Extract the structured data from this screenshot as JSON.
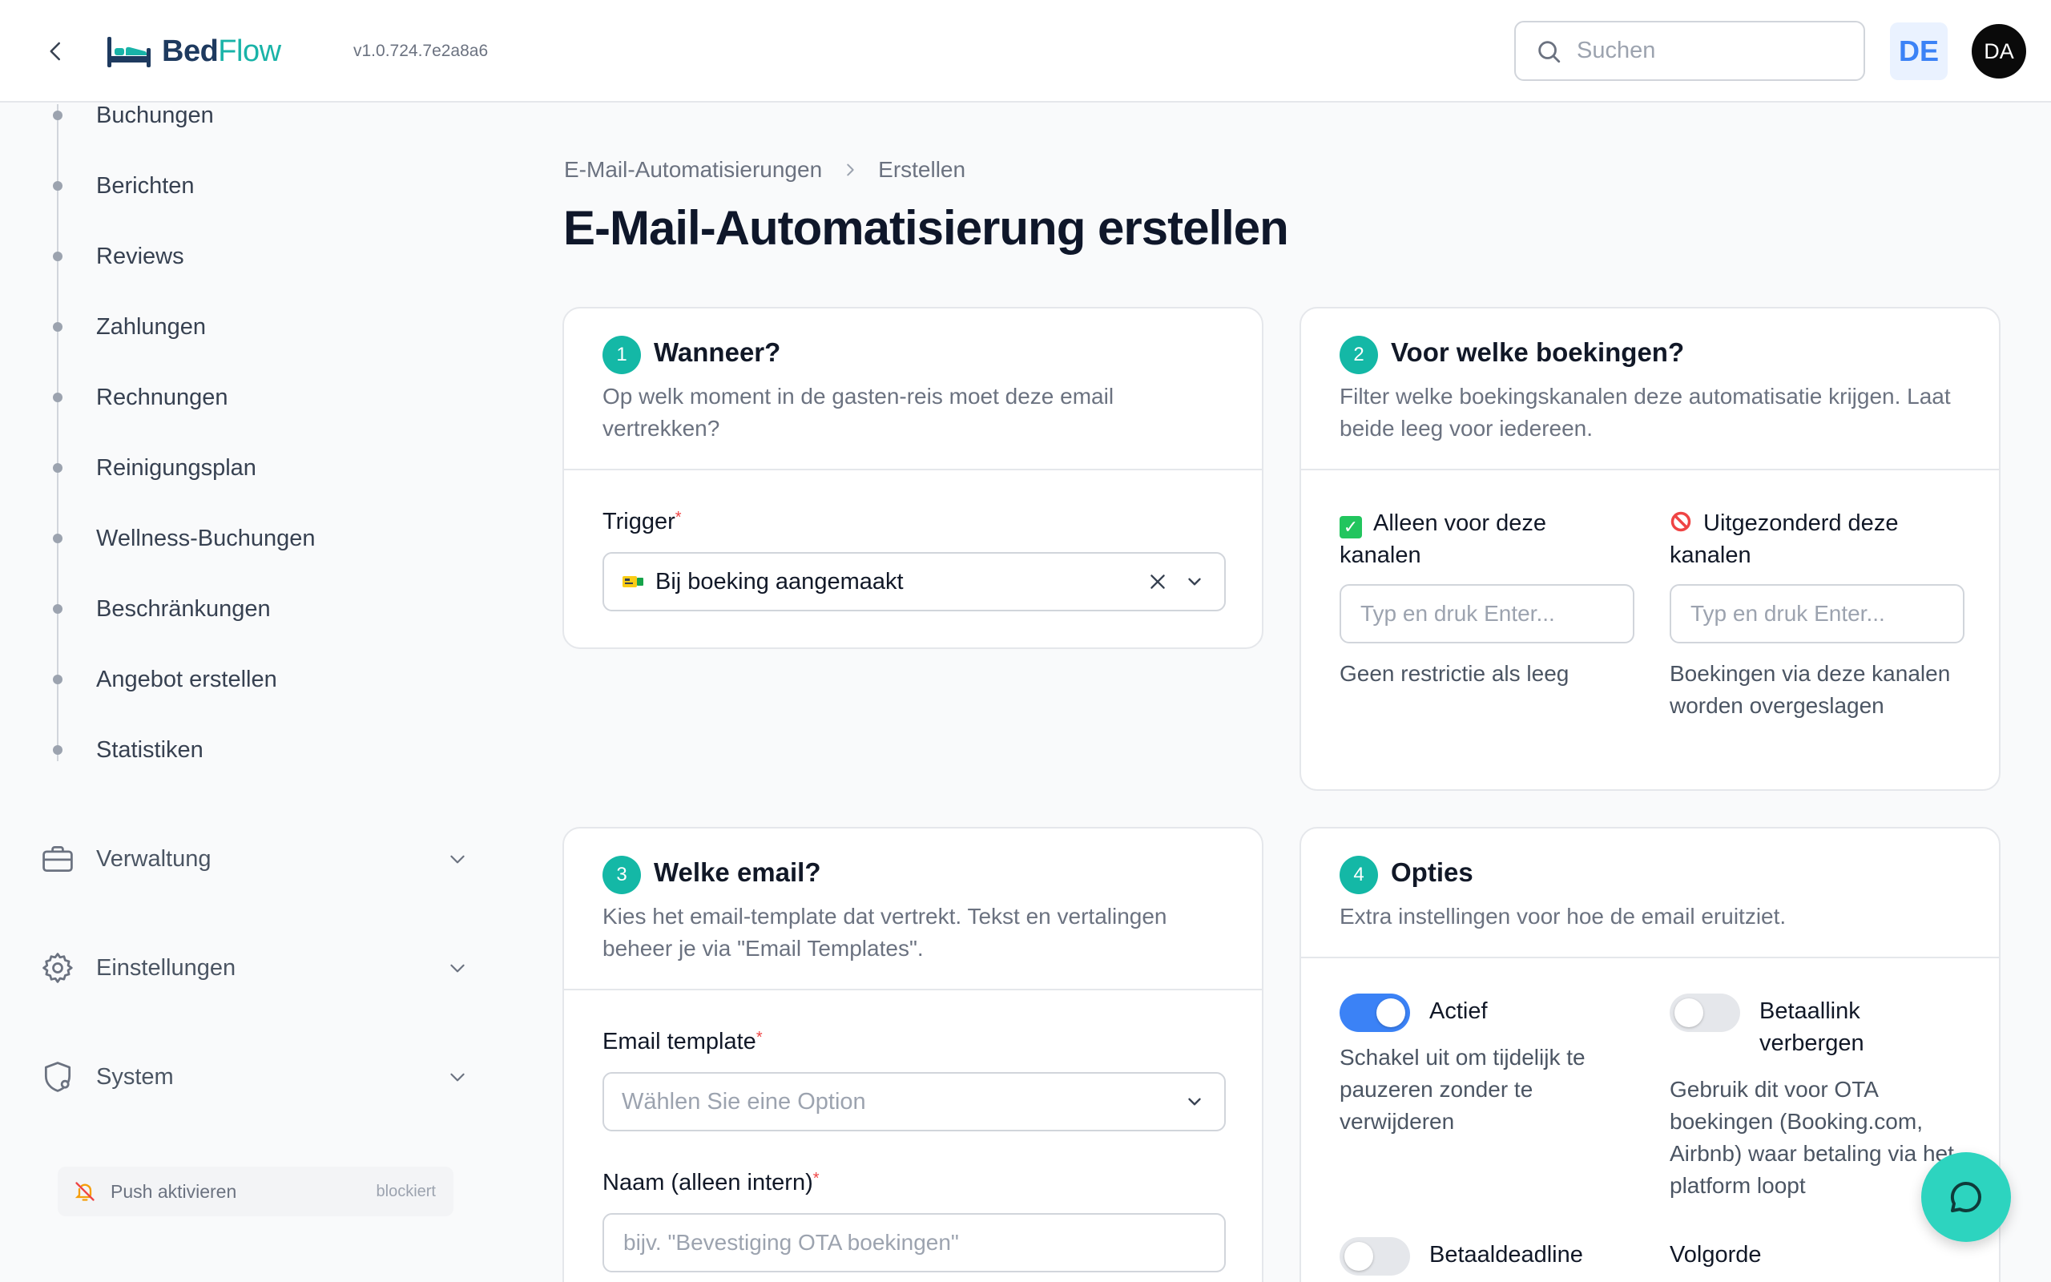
{
  "header": {
    "logo_part1": "Bed",
    "logo_part2": "Flow",
    "version": "v1.0.724.7e2a8a6",
    "search_placeholder": "Suchen",
    "language": "DE",
    "avatar_initials": "DA"
  },
  "sidebar": {
    "sub_items": [
      "Buchungen",
      "Berichten",
      "Reviews",
      "Zahlungen",
      "Rechnungen",
      "Reinigungsplan",
      "Wellness-Buchungen",
      "Beschränkungen",
      "Angebot erstellen",
      "Statistiken"
    ],
    "groups": [
      {
        "label": "Verwaltung",
        "icon": "briefcase-icon"
      },
      {
        "label": "Einstellungen",
        "icon": "gear-icon"
      },
      {
        "label": "System",
        "icon": "shield-gear-icon"
      }
    ],
    "push": {
      "label": "Push aktivieren",
      "status": "blockiert",
      "icon": "bell-off-icon"
    }
  },
  "breadcrumb": {
    "parent": "E-Mail-Automatisierungen",
    "current": "Erstellen"
  },
  "page_title": "E-Mail-Automatisierung erstellen",
  "card1": {
    "step": "1",
    "title": "Wanneer?",
    "description": "Op welk moment in de gasten-reis moet deze email vertrekken?",
    "trigger_label": "Trigger",
    "required_mark": "*",
    "trigger_value": "Bij boeking aangemaakt"
  },
  "card2": {
    "step": "2",
    "title": "Voor welke boekingen?",
    "description": "Filter welke boekingskanalen deze automatisatie krijgen. Laat beide leeg voor iedereen.",
    "include": {
      "emoji": "✅",
      "label": "Alleen voor deze kanalen",
      "placeholder": "Typ en druk Enter...",
      "help": "Geen restrictie als leeg"
    },
    "exclude": {
      "emoji": "🚫",
      "label": "Uitgezonderd deze kanalen",
      "placeholder": "Typ en druk Enter...",
      "help": "Boekingen via deze kanalen worden overgeslagen"
    }
  },
  "card3": {
    "step": "3",
    "title": "Welke email?",
    "description": "Kies het email-template dat vertrekt. Tekst en vertalingen beheer je via \"Email Templates\".",
    "template_label": "Email template",
    "template_placeholder": "Wählen Sie eine Option",
    "name_label": "Naam (alleen intern)",
    "name_placeholder": "bijv. \"Bevestiging OTA boekingen\""
  },
  "card4": {
    "step": "4",
    "title": "Opties",
    "description": "Extra instellingen voor hoe de email eruitziet.",
    "actief": {
      "label": "Actief",
      "help": "Schakel uit om tijdelijk te pauzeren zonder te verwijderen",
      "on": true
    },
    "betaallink": {
      "label": "Betaallink verbergen",
      "help": "Gebruik dit voor OTA boekingen (Booking.com, Airbnb) waar betaling via het platform loopt",
      "on": false
    },
    "betaaldeadline": {
      "label": "Betaaldeadline",
      "on": false
    },
    "volgorde": {
      "label": "Volgorde"
    }
  },
  "colors": {
    "brand_teal": "#14b8a6",
    "toggle_on": "#3b82f6",
    "required": "#ef4444"
  }
}
